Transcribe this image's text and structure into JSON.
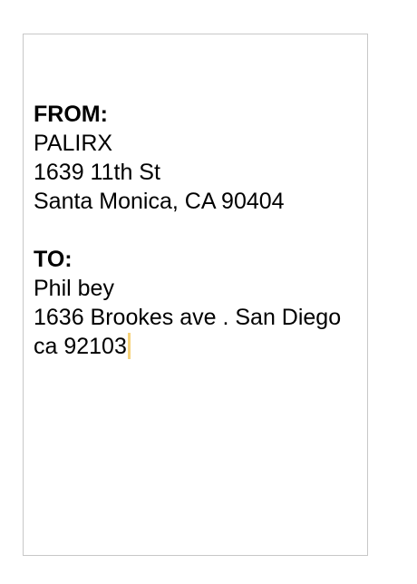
{
  "from": {
    "heading": "FROM:",
    "name": "PALIRX",
    "street": "1639 11th St",
    "city_line": "Santa Monica, CA 90404"
  },
  "to": {
    "heading": "TO:",
    "name": "Phil bey",
    "street": "1636 Brookes ave . San Diego",
    "city_line": "ca 92103"
  },
  "colors": {
    "text": "#000000",
    "page_border": "#c8c8c8",
    "caret": "#f5d27a"
  }
}
